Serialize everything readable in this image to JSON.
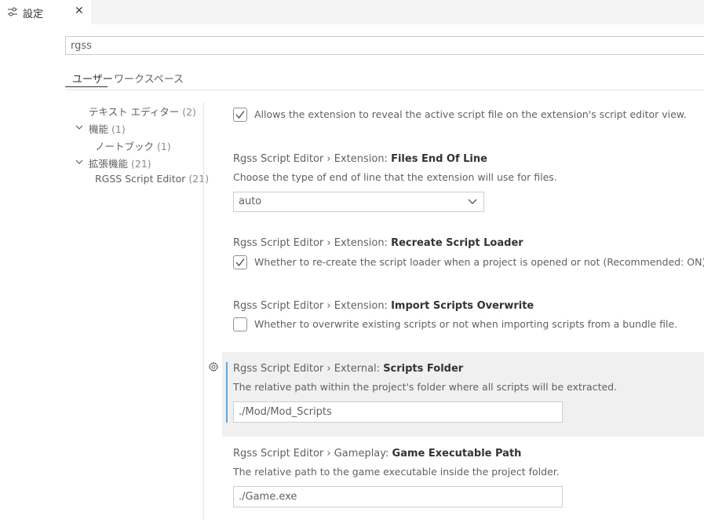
{
  "tab": {
    "title": "設定",
    "close": "✕"
  },
  "search": {
    "value": "rgss"
  },
  "scope_tabs": {
    "user": "ユーザー",
    "workspace": "ワークスペース"
  },
  "toc": [
    {
      "label": "テキスト エディター",
      "count": "(2)"
    },
    {
      "label": "機能",
      "count": "(1)"
    },
    {
      "label": "ノートブック",
      "count": "(1)"
    },
    {
      "label": "拡張機能",
      "count": "(21)"
    },
    {
      "label": "RGSS Script Editor",
      "count": "(21)"
    }
  ],
  "settings": {
    "reveal": {
      "checked": true,
      "desc": "Allows the extension to reveal the active script file on the extension's script editor view."
    },
    "eol": {
      "prefix": "Rgss Script Editor › Extension: ",
      "name": "Files End Of Line",
      "desc": "Choose the type of end of line that the extension will use for files.",
      "value": "auto"
    },
    "recreate": {
      "prefix": "Rgss Script Editor › Extension: ",
      "name": "Recreate Script Loader",
      "checked": true,
      "desc": "Whether to re-create the script loader when a project is opened or not (Recommended: ON)."
    },
    "overwrite": {
      "prefix": "Rgss Script Editor › Extension: ",
      "name": "Import Scripts Overwrite",
      "checked": false,
      "desc": "Whether to overwrite existing scripts or not when importing scripts from a bundle file."
    },
    "folder": {
      "prefix": "Rgss Script Editor › External: ",
      "name": "Scripts Folder",
      "desc": "The relative path within the project's folder where all scripts will be extracted.",
      "value": "./Mod/Mod_Scripts"
    },
    "exe": {
      "prefix": "Rgss Script Editor › Gameplay: ",
      "name": "Game Executable Path",
      "desc": "The relative path to the game executable inside the project folder.",
      "value": "./Game.exe"
    }
  },
  "colors": {
    "accent": "#64a7d9",
    "focused_bg": "#f0f0f0"
  },
  "icons": {
    "tab": "settings-sliders-icon",
    "gear": "gear-icon",
    "chevron": "chevron-down-icon",
    "check": "check-icon"
  }
}
